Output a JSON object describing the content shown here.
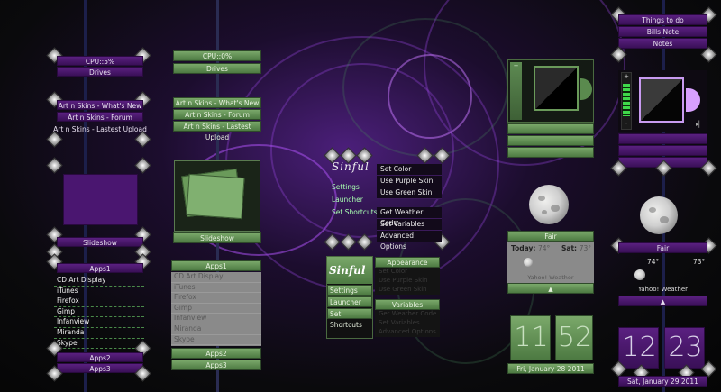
{
  "left_purple": {
    "cpu": "CPU::5%",
    "drives": "Drives",
    "links": [
      "Art n Skins - What's New",
      "Art n Skins - Forum",
      "Art n Skins - Lastest Upload"
    ],
    "slideshow": "Slideshow",
    "apps1": "Apps1",
    "apps_list": [
      "CD Art Display",
      "iTunes",
      "Firefox",
      "Gimp",
      "Infanview",
      "Miranda",
      "Skype"
    ],
    "apps2": "Apps2",
    "apps3": "Apps3"
  },
  "left_green": {
    "cpu": "CPU::0%",
    "drives": "Drives",
    "links": [
      "Art n Skins - What's New",
      "Art n Skins - Forum",
      "Art n Skins - Lastest Upload"
    ],
    "slideshow": "Slideshow",
    "apps1": "Apps1",
    "apps_list": [
      "CD Art Display",
      "iTunes",
      "Firefox",
      "Gimp",
      "Infanview",
      "Miranda",
      "Skype"
    ],
    "apps2": "Apps2",
    "apps3": "Apps3"
  },
  "sinful_purple": {
    "logo": "Sinful",
    "items": [
      "Settings",
      "Launcher",
      "Set Shortcuts"
    ],
    "menu": [
      "Set Color",
      "Use Purple Skin",
      "Use Green Skin",
      "Get Weather Code",
      "Set Variables",
      "Advanced Options"
    ]
  },
  "sinful_green": {
    "logo": "Sinful",
    "items": [
      "Settings",
      "Launcher",
      "Set Shortcuts"
    ],
    "appearance": "Appearance",
    "appearance_items": [
      "Set Color",
      "Use Purple Skin",
      "Use Green Skin"
    ],
    "variables": "Variables",
    "variable_items": [
      "Get Weather Code",
      "Set Variables",
      "Advanced Options"
    ]
  },
  "weather_green": {
    "condition": "Fair",
    "today_label": "Today:",
    "today_temp": "74°",
    "sat_label": "Sat:",
    "sat_temp": "73°",
    "source": "Yahoo! Weather"
  },
  "clock_green": {
    "hour": "11",
    "minute": "52",
    "date": "Fri, January 28 2011"
  },
  "right_purple": {
    "notes": [
      "Things to do",
      "Bills Note",
      "Notes"
    ],
    "weather_condition": "Fair",
    "temp_left": "74°",
    "temp_right": "73°",
    "source": "Yahoo! Weather",
    "hour": "12",
    "minute": "23",
    "date": "Sat, January 29 2011",
    "player_plus": "+",
    "player_minus": "-",
    "player_next": "▸▏"
  },
  "colors": {
    "purple": "#4d1a72",
    "green": "#6a9a5a",
    "lavender": "#d8a0ff"
  }
}
